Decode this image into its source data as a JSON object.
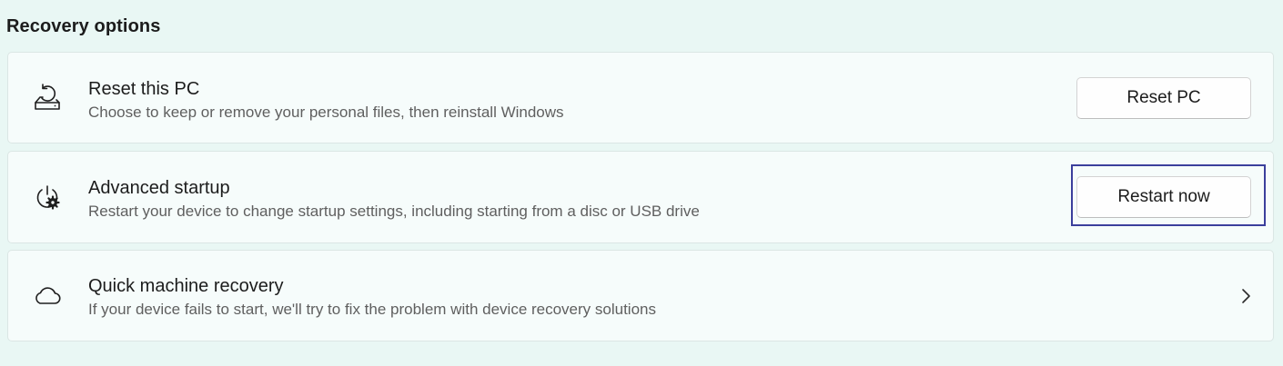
{
  "section": {
    "title": "Recovery options"
  },
  "items": [
    {
      "title": "Reset this PC",
      "description": "Choose to keep or remove your personal files, then reinstall Windows",
      "icon": "reset-pc-icon",
      "button_label": "Reset PC"
    },
    {
      "title": "Advanced startup",
      "description": "Restart your device to change startup settings, including starting from a disc or USB drive",
      "icon": "advanced-startup-icon",
      "button_label": "Restart now"
    },
    {
      "title": "Quick machine recovery",
      "description": "If your device fails to start, we'll try to fix the problem with device recovery solutions",
      "icon": "cloud-icon",
      "action_icon": "chevron-right-icon"
    }
  ],
  "colors": {
    "background": "#e9f7f4",
    "card": "#f6fcfb",
    "focus_ring": "#3b3f9c"
  }
}
